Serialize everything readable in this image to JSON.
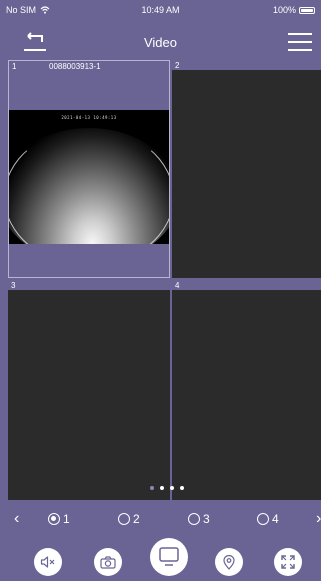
{
  "status_bar": {
    "carrier": "No SIM",
    "time": "10:49 AM",
    "battery": "100%"
  },
  "nav": {
    "title": "Video"
  },
  "cells": [
    {
      "index": "1",
      "device_id": "0088003913-1",
      "timestamp": "2021-04-13  10:49:13"
    },
    {
      "index": "2"
    },
    {
      "index": "3"
    },
    {
      "index": "4"
    }
  ],
  "page_indicator": {
    "count": 4,
    "active": 2
  },
  "channels": {
    "prev_icon": "‹",
    "next_icon": "›",
    "options": [
      "1",
      "2",
      "3",
      "4"
    ],
    "selected": "1"
  },
  "actions": [
    {
      "icon": "mute-icon"
    },
    {
      "icon": "camera-icon"
    },
    {
      "icon": "monitor-icon"
    },
    {
      "icon": "location-pin-icon"
    },
    {
      "icon": "fullscreen-icon"
    }
  ],
  "colors": {
    "accent": "#6a6494",
    "cell_bg": "#2b2b2b",
    "icon_fg": "#6a6494"
  }
}
